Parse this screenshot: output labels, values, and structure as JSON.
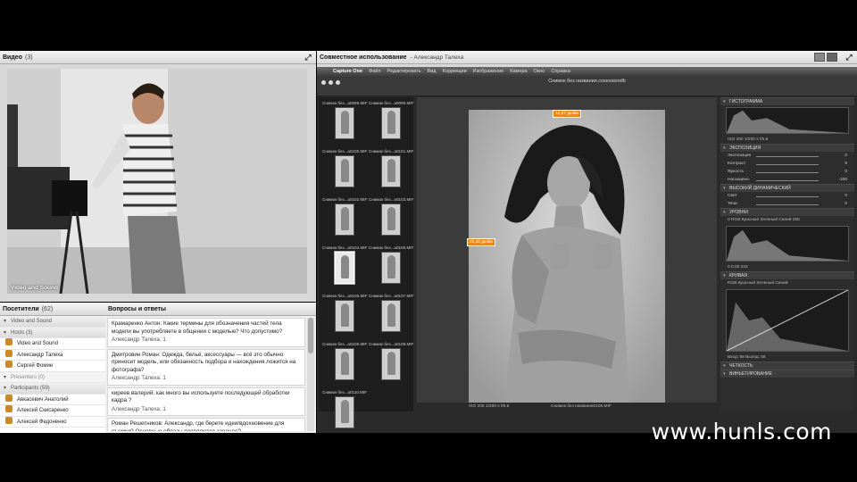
{
  "video": {
    "title": "Видео",
    "count": "(3)",
    "overlay": "Video and Sound"
  },
  "attendees": {
    "title": "Посетители",
    "count": "(62)",
    "rows": [
      {
        "label": "Video and Sound",
        "kind": "group"
      },
      {
        "label": "Hosts (3)",
        "kind": "group"
      },
      {
        "label": "Video and Sound",
        "kind": "user"
      },
      {
        "label": "Александр Талеха",
        "kind": "user"
      },
      {
        "label": "Сергей Фомин",
        "kind": "user"
      },
      {
        "label": "Presenters (0)",
        "kind": "grey"
      },
      {
        "label": "Participants (59)",
        "kind": "group"
      },
      {
        "label": "Авкасевич Анатолий",
        "kind": "user"
      },
      {
        "label": "Алексей Скисаренко",
        "kind": "user"
      },
      {
        "label": "Алексей Федоненко",
        "kind": "user"
      }
    ]
  },
  "qa": {
    "title": "Вопросы и ответы",
    "items": [
      {
        "q": "Крамаренко Антон: Какие термины для обозначения частей тела модели вы употребляете в общении с моделью? Что допустимо?",
        "a": "Александр Талеха: 1"
      },
      {
        "q": "Дмитровин Роман: Одежда, бельё, аксессуары — всё это обычно приносит модель, или обязанность подбора и нахождения ложится на фотографа?",
        "a": "Александр Талеха: 1"
      },
      {
        "q": "киреев валерий: как много вы используете последующей обработки кадра ?",
        "a": "Александр Талеха: 1"
      },
      {
        "q": "Роман Решетников: Александр, где берете идеи/вдохновение для съемки? Основные образы появляются заранее?",
        "a": ""
      }
    ]
  },
  "share": {
    "title": "Совместное использование",
    "presenter": "- Александр Талеха"
  },
  "capture": {
    "menu": [
      "Capture One",
      "Файл",
      "Редактировать",
      "Вид",
      "Коррекции",
      "Изображение",
      "Камера",
      "Окно",
      "Справка"
    ],
    "doc_title": "Снимок без названия.cosessiondb",
    "thumbs": [
      "Снимок без...a0098.MIF",
      "Снимок без...a0099.MIF",
      "Снимок без...a0100.MIF",
      "Снимок без...a0101.MIF",
      "Снимок без...a0102.MIF",
      "Снимок без...a0103.MIF",
      "Снимок без...a0104.MIF",
      "Снимок без...a0105.MIF",
      "Снимок без...a0106.MIF",
      "Снимок без...a0107.MIF",
      "Снимок без...a0108.MIF",
      "Снимок без...a0109.MIF",
      "Снимок без...a0110.MIF"
    ],
    "selected_thumb": 6,
    "tag_top": "14,87 дюйм",
    "tag_left": "21,40 дюйм",
    "viewer_status_left": "ISO 200   1/200 s   f/5.6",
    "viewer_status_mid": "Снимок без названия0106.MIF",
    "tools": [
      {
        "type": "sec",
        "label": "ГИСТОГРАММА"
      },
      {
        "type": "hist"
      },
      {
        "type": "info",
        "label": "ISO 200          1/200 s          f/5.6"
      },
      {
        "type": "sec",
        "label": "ЭКСПОЗИЦИЯ"
      },
      {
        "type": "sld",
        "label": "Экспозиция",
        "val": "0"
      },
      {
        "type": "sld",
        "label": "Контраст",
        "val": "8"
      },
      {
        "type": "sld",
        "label": "Яркость",
        "val": "0"
      },
      {
        "type": "sld",
        "label": "Насыщенн.",
        "val": "-100"
      },
      {
        "type": "sec",
        "label": "ВЫСОКИЙ ДИНАМИЧЕСКИЙ"
      },
      {
        "type": "sld",
        "label": "Свет",
        "val": "0"
      },
      {
        "type": "sld",
        "label": "Тени",
        "val": "0"
      },
      {
        "type": "sec",
        "label": "УРОВНИ"
      },
      {
        "type": "info",
        "label": "0     RGB  Красный  Зеленый  Синий     255"
      },
      {
        "type": "levels"
      },
      {
        "type": "info",
        "label": "0          0,00          216"
      },
      {
        "type": "sec",
        "label": "КРИВАЯ"
      },
      {
        "type": "info",
        "label": "RGB  Красный  Зеленый  Синий"
      },
      {
        "type": "curve"
      },
      {
        "type": "info",
        "label": "Вход: 58    Выход: 58"
      },
      {
        "type": "sec",
        "label": "ЧЕТКОСТЬ"
      },
      {
        "type": "sec",
        "label": "ВИНЬЕТИРОВАНИЕ"
      }
    ]
  },
  "watermark": "www.hunls.com"
}
